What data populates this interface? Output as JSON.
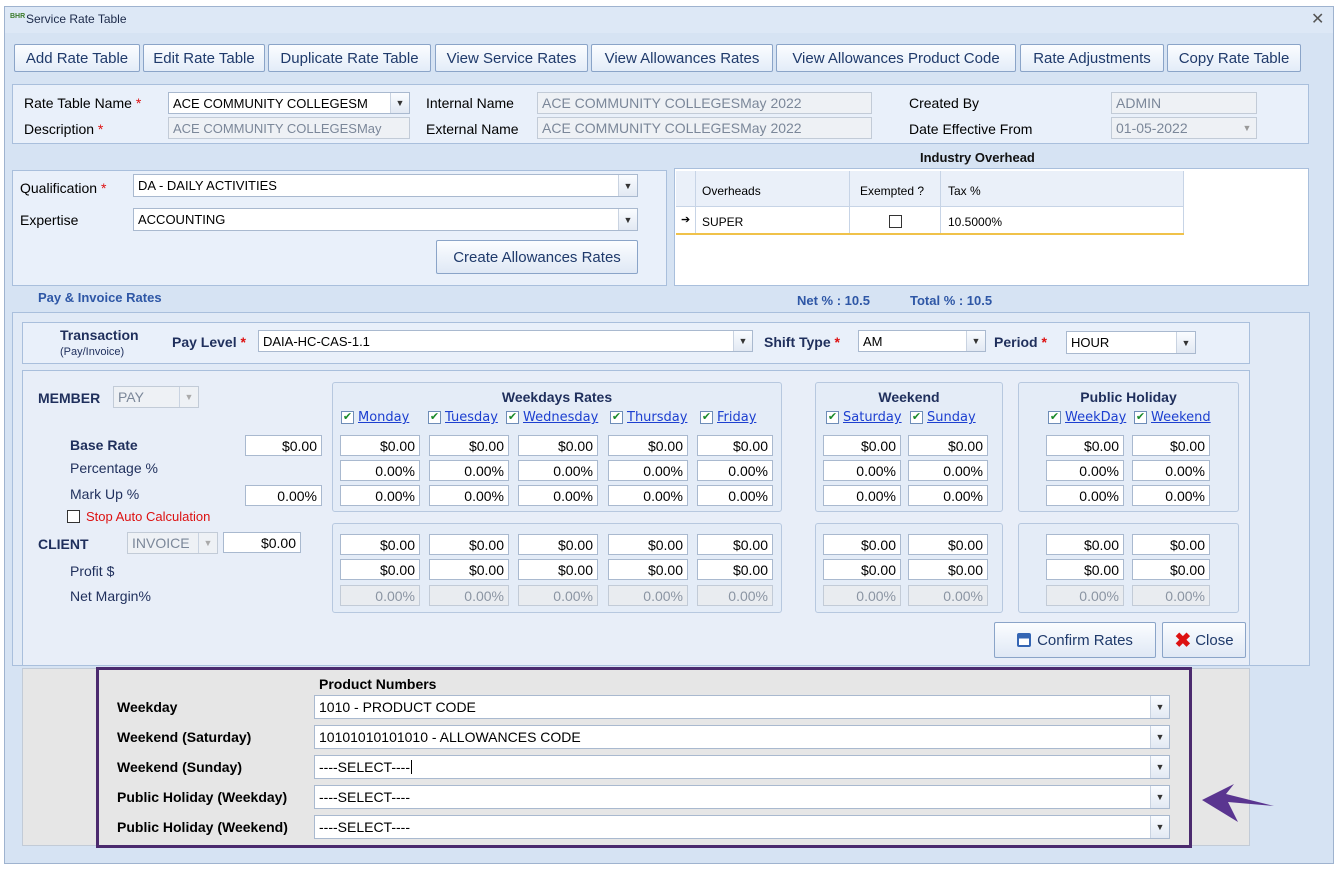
{
  "window": {
    "title": "Service Rate Table",
    "app_icon_text": "BHR"
  },
  "toolbar": {
    "buttons": [
      "Add Rate Table",
      "Edit Rate Table",
      "Duplicate Rate Table",
      "View Service Rates",
      "View Allowances Rates",
      "View Allowances Product Code",
      "Rate Adjustments",
      "Copy Rate Table"
    ]
  },
  "header": {
    "rate_table_name_label": "Rate Table Name",
    "rate_table_name_value": "ACE COMMUNITY COLLEGESM",
    "description_label": "Description",
    "description_value": "ACE COMMUNITY COLLEGESMay",
    "internal_name_label": "Internal Name",
    "internal_name_value": "ACE COMMUNITY COLLEGESMay 2022",
    "external_name_label": "External Name",
    "external_name_value": "ACE COMMUNITY COLLEGESMay 2022",
    "created_by_label": "Created By",
    "created_by_value": "ADMIN",
    "date_effective_label": "Date Effective From",
    "date_effective_value": "01-05-2022",
    "required_mark": "*"
  },
  "qualification": {
    "qualification_label": "Qualification",
    "qualification_value": "DA - DAILY ACTIVITIES",
    "expertise_label": "Expertise",
    "expertise_value": "ACCOUNTING",
    "create_allowances_button": "Create Allowances Rates"
  },
  "overhead": {
    "title": "Industry Overhead",
    "columns": [
      "Overheads",
      "Exempted ?",
      "Tax %"
    ],
    "row": {
      "name": "SUPER",
      "tax": "10.5000%"
    },
    "net_label": "Net % : 10.5",
    "total_label": "Total % : 10.5"
  },
  "pay_invoice_title": "Pay & Invoice Rates",
  "transaction": {
    "label": "Transaction",
    "sublabel": "(Pay/Invoice)",
    "pay_level_label": "Pay Level",
    "pay_level_value": "DAIA-HC-CAS-1.1",
    "shift_type_label": "Shift Type",
    "shift_type_value": "AM",
    "period_label": "Period",
    "period_value": "HOUR"
  },
  "member": {
    "label": "MEMBER",
    "type_value": "PAY",
    "base_rate_label": "Base Rate",
    "base_rate_value": "$0.00",
    "percentage_label": "Percentage %",
    "markup_label": "Mark Up %",
    "markup_value": "0.00%",
    "stop_auto_label": "Stop Auto Calculation"
  },
  "client": {
    "label": "CLIENT",
    "type_value": "INVOICE",
    "value": "$0.00",
    "profit_label": "Profit $",
    "net_margin_label": "Net Margin%"
  },
  "groups": {
    "weekdays_title": "Weekdays Rates",
    "weekend_title": "Weekend",
    "holiday_title": "Public Holiday",
    "days": [
      "Monday",
      "Tuesday",
      "Wednesday",
      "Thursday",
      "Friday",
      "Saturday",
      "Sunday",
      "WeekDay",
      "Weekend"
    ]
  },
  "cells": {
    "dollar": "$0.00",
    "pct": "0.00%"
  },
  "actions": {
    "confirm": "Confirm Rates",
    "close": "Close"
  },
  "product_numbers": {
    "title": "Product Numbers",
    "rows": [
      {
        "label": "Weekday",
        "value": "1010 - PRODUCT CODE"
      },
      {
        "label": "Weekend (Saturday)",
        "value": "10101010101010 - ALLOWANCES CODE"
      },
      {
        "label": "Weekend (Sunday)",
        "value": "----SELECT----"
      },
      {
        "label": "Public Holiday (Weekday)",
        "value": "----SELECT----"
      },
      {
        "label": "Public Holiday (Weekend)",
        "value": "----SELECT----"
      }
    ]
  },
  "colors": {
    "highlight_border": "#4b2a6e",
    "accent_blue": "#1f3a6b"
  }
}
